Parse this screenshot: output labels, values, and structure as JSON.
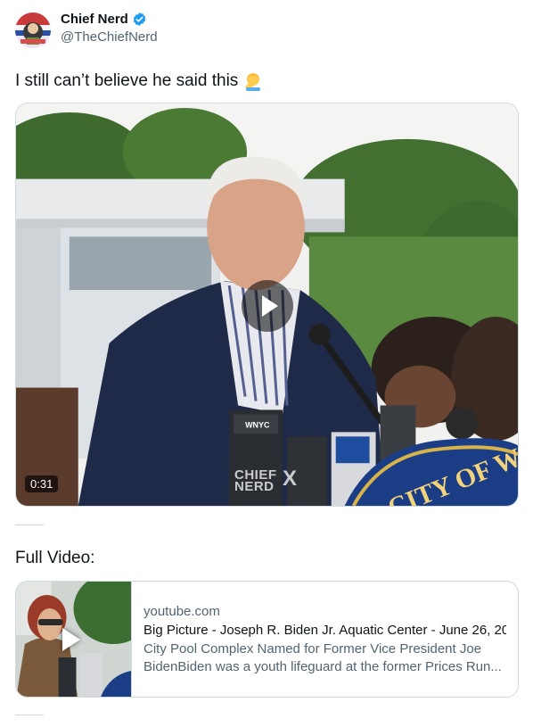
{
  "author": {
    "display_name": "Chief Nerd",
    "handle": "@TheChiefNerd"
  },
  "tweet": {
    "text": "I still can’t believe he said this"
  },
  "video": {
    "duration": "0:31",
    "watermark": "CHIEF NERD",
    "watermark_x": "X",
    "seal_text": "CITY OF W",
    "mic_label": "WNYC"
  },
  "reply": {
    "text": "Full Video:"
  },
  "link_card": {
    "domain": "youtube.com",
    "title": "Big Picture - Joseph R. Biden Jr. Aquatic Center - June 26, 20",
    "description_line1": "City Pool Complex Named for Former Vice President Joe",
    "description_line2": "BidenBiden was a youth lifeguard at the former Prices Run..."
  },
  "colors": {
    "verified": "#1d9bf0",
    "text": "#0f1419",
    "muted": "#536471",
    "border": "#cfd9de"
  }
}
